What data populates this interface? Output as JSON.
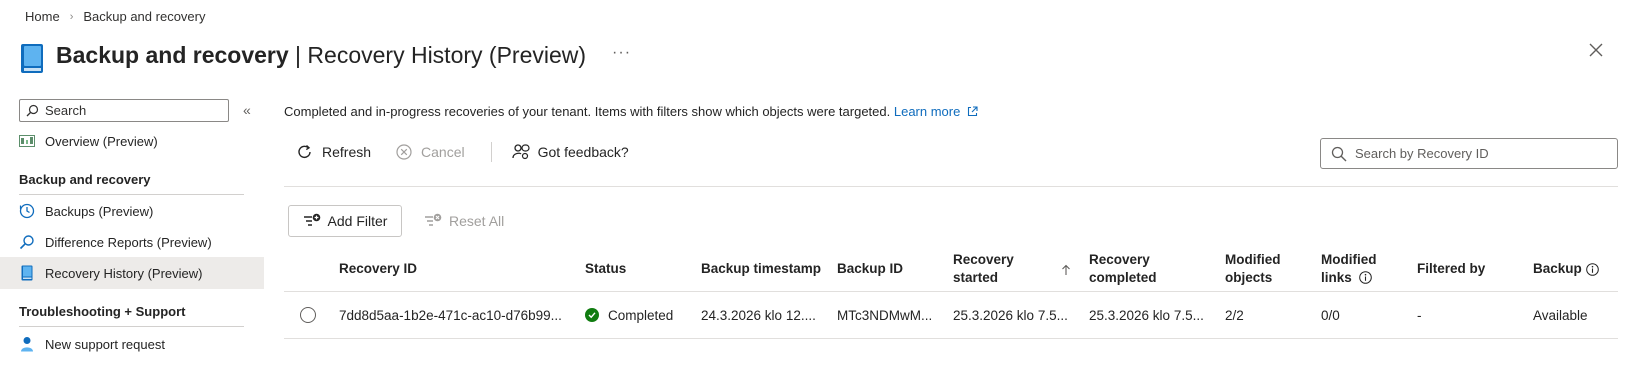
{
  "breadcrumb": {
    "home": "Home",
    "current": "Backup and recovery"
  },
  "header": {
    "title_bold": "Backup and recovery",
    "title_rest": " | Recovery History (Preview)",
    "more": "···"
  },
  "sidebar": {
    "search_placeholder": "Search",
    "collapse": "«",
    "items": [
      {
        "label": "Overview (Preview)",
        "icon": "overview-icon"
      },
      {
        "label": "Backups (Preview)",
        "icon": "clock-icon"
      },
      {
        "label": "Difference Reports (Preview)",
        "icon": "search-icon"
      },
      {
        "label": "Recovery History (Preview)",
        "icon": "book-icon",
        "active": true
      },
      {
        "label": "New support request",
        "icon": "person-icon"
      }
    ],
    "sections": [
      "Backup and recovery",
      "Troubleshooting + Support"
    ]
  },
  "main": {
    "description": "Completed and in-progress recoveries of your tenant. Items with filters show which objects were targeted.",
    "learn_more": "Learn more",
    "toolbar": {
      "refresh": "Refresh",
      "cancel": "Cancel",
      "feedback": "Got feedback?"
    },
    "search_placeholder": "Search by Recovery ID",
    "add_filter": "Add Filter",
    "reset_all": "Reset All"
  },
  "table": {
    "columns": [
      {
        "line1": "Recovery ID",
        "line2": ""
      },
      {
        "line1": "Status",
        "line2": ""
      },
      {
        "line1": "Backup timestamp",
        "line2": ""
      },
      {
        "line1": "Backup ID",
        "line2": ""
      },
      {
        "line1": "Recovery",
        "line2": "started"
      },
      {
        "line1": "Recovery",
        "line2": "completed"
      },
      {
        "line1": "Modified",
        "line2": "objects"
      },
      {
        "line1": "Modified",
        "line2": "links"
      },
      {
        "line1": "Filtered by",
        "line2": ""
      },
      {
        "line1": "Backup",
        "line2": ""
      }
    ],
    "rows": [
      {
        "recovery_id": "7dd8d5aa-1b2e-471c-ac10-d76b99...",
        "status": "Completed",
        "backup_timestamp": "24.3.2026 klo 12....",
        "backup_id": "MTc3NDMwM...",
        "recovery_started": "25.3.2026 klo 7.5...",
        "recovery_completed": "25.3.2026 klo 7.5...",
        "modified_objects": "2/2",
        "modified_links": "0/0",
        "filtered_by": "-",
        "backup": "Available"
      }
    ]
  },
  "colors": {
    "accent": "#0f6cbd",
    "success": "#107c10",
    "active_bg": "#edebe9"
  }
}
